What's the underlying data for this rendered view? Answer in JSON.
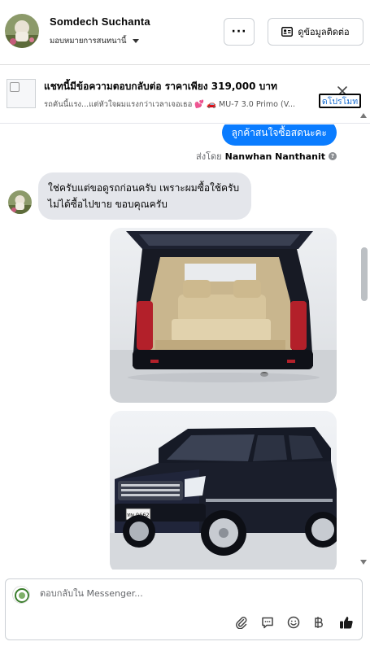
{
  "header": {
    "contact_name": "Somdech Suchanta",
    "assign_label": "มอบหมายการสนทนานี้",
    "more_label": "···",
    "contact_info_label": "ดูข้อมูลติดต่อ"
  },
  "banner": {
    "title": "แชทนี้มีข้อความตอบกลับต่อ ราคาเพียง 319,000 บาท",
    "subtitle": "รถคันนี้แรง...แต่หัวใจผมแรงกว่าเวลาเจอเธอ 💕 🚗 MU-7 3.0 Primo (V...",
    "promote_label": "ดโปรโมท"
  },
  "chat": {
    "outgoing_text": "ลูกค้าสนใจซื้อสดนะคะ",
    "sent_by_prefix": "ส่งโดย",
    "sent_by_name": "Nanwhan Nanthanit",
    "incoming_text": "ใช่ครับแต่ขอดูรถก่อนครับ เพราะผมซื้อใช้ครับ ไม่ได้ซื้อไปขาย ขอบคุณครับ",
    "plate_text": "ทพ 9662"
  },
  "composer": {
    "placeholder": "ตอบกลับใน Messenger..."
  },
  "icons": [
    "more-icon",
    "contact-card-icon",
    "close-icon",
    "help-icon",
    "attach-icon",
    "saved-reply-icon",
    "emoji-icon",
    "baht-icon",
    "like-icon"
  ],
  "colors": {
    "accent": "#0a7cff",
    "incoming_bubble": "#e4e6eb",
    "link": "#1c6fd1"
  }
}
